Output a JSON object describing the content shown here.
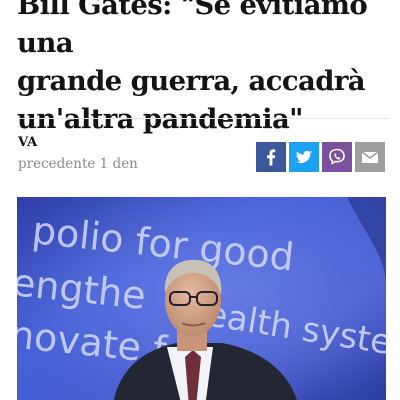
{
  "article": {
    "headline": "Bill Gates: \"Se evitiamo una\ngrande guerra, accadrà\nun'altra pandemia\"",
    "author": "VA",
    "timestamp": "precedente 1 den"
  },
  "share": [
    {
      "network": "facebook",
      "icon": "facebook-icon",
      "color": "#3b5998"
    },
    {
      "network": "twitter",
      "icon": "twitter-icon",
      "color": "#1da1f2"
    },
    {
      "network": "viber",
      "icon": "viber-icon",
      "color": "#7b519d"
    },
    {
      "network": "email",
      "icon": "email-icon",
      "color": "#9e9e9e"
    }
  ],
  "photo": {
    "backdrop_lines": [
      "polio for good",
      "engthe",
      "ealth systems",
      "novate f"
    ]
  }
}
